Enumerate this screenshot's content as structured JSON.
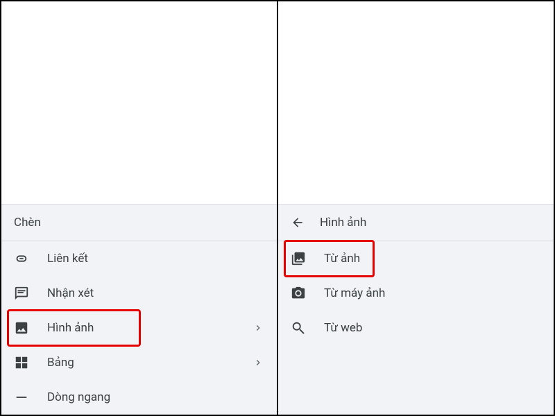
{
  "left": {
    "header": "Chèn",
    "items": [
      {
        "icon": "link",
        "label": "Liên kết",
        "hasSubmenu": false
      },
      {
        "icon": "comment",
        "label": "Nhận xét",
        "hasSubmenu": false
      },
      {
        "icon": "image",
        "label": "Hình ảnh",
        "hasSubmenu": true,
        "highlighted": true
      },
      {
        "icon": "table",
        "label": "Bảng",
        "hasSubmenu": true
      },
      {
        "icon": "hr",
        "label": "Dòng ngang",
        "hasSubmenu": false
      }
    ]
  },
  "right": {
    "header": "Hình ảnh",
    "items": [
      {
        "icon": "photos",
        "label": "Từ ảnh",
        "highlighted": true
      },
      {
        "icon": "camera",
        "label": "Từ máy ảnh"
      },
      {
        "icon": "search",
        "label": "Từ web"
      }
    ]
  }
}
